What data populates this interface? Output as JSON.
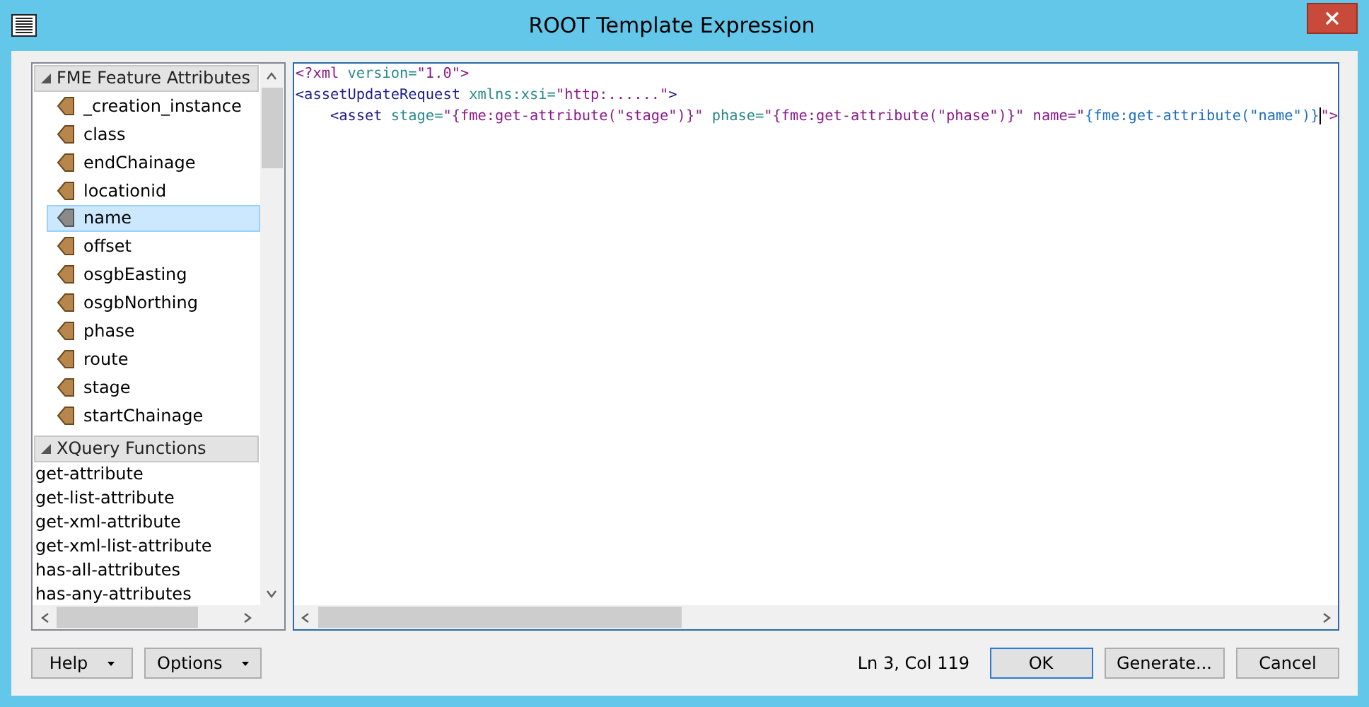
{
  "window": {
    "title": "ROOT Template Expression"
  },
  "attributes": {
    "header": "FME Feature Attributes",
    "expanded": true,
    "items": [
      {
        "label": "_creation_instance",
        "selected": false
      },
      {
        "label": "class",
        "selected": false
      },
      {
        "label": "endChainage",
        "selected": false
      },
      {
        "label": "locationid",
        "selected": false
      },
      {
        "label": "name",
        "selected": true
      },
      {
        "label": "offset",
        "selected": false
      },
      {
        "label": "osgbEasting",
        "selected": false
      },
      {
        "label": "osgbNorthing",
        "selected": false
      },
      {
        "label": "phase",
        "selected": false
      },
      {
        "label": "route",
        "selected": false
      },
      {
        "label": "stage",
        "selected": false
      },
      {
        "label": "startChainage",
        "selected": false
      }
    ]
  },
  "functions": {
    "header": "XQuery Functions",
    "expanded": true,
    "items": [
      {
        "label": "get-attribute"
      },
      {
        "label": "get-list-attribute"
      },
      {
        "label": "get-xml-attribute"
      },
      {
        "label": "get-xml-list-attribute"
      },
      {
        "label": "has-all-attributes"
      },
      {
        "label": "has-any-attributes"
      }
    ]
  },
  "editor": {
    "lines": [
      [
        {
          "kind": "decl",
          "text": "<?xml"
        },
        {
          "kind": "attr",
          "text": " version="
        },
        {
          "kind": "value",
          "text": "\"1.0\">"
        }
      ],
      [
        {
          "kind": "tag",
          "text": "<assetUpdateRequest"
        },
        {
          "kind": "attr",
          "text": " xmlns:xsi="
        },
        {
          "kind": "value",
          "text": "\"http:......\""
        },
        {
          "kind": "tag",
          "text": ">"
        }
      ],
      [
        {
          "kind": "tag",
          "text": "    <asset"
        },
        {
          "kind": "attr",
          "text": " stage="
        },
        {
          "kind": "value",
          "text": "\"{fme:get-attribute(\"stage\")}\""
        },
        {
          "kind": "attr",
          "text": " phase="
        },
        {
          "kind": "value",
          "text": "\"{fme:get-attribute(\"phase\")}\""
        },
        {
          "kind": "value",
          "text": " name=\""
        },
        {
          "kind": "expr",
          "text": "{fme:get-attribute(\"name\")}",
          "cursor": true
        },
        {
          "kind": "value",
          "text": "\">"
        }
      ]
    ]
  },
  "status": "Ln 3, Col 119",
  "buttons": [
    {
      "label": "Help",
      "kind": "menu"
    },
    {
      "label": "Options",
      "kind": "menu"
    },
    {
      "label": "OK",
      "kind": "default"
    },
    {
      "label": "Generate...",
      "kind": "push"
    },
    {
      "label": "Cancel",
      "kind": "push"
    }
  ]
}
